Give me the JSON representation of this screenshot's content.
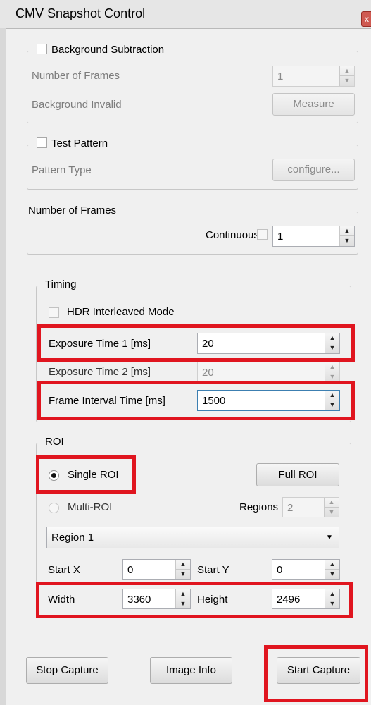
{
  "window": {
    "title": "CMV Snapshot Control",
    "close_glyph": "x"
  },
  "background_subtraction": {
    "label": "Background Subtraction",
    "frames_label": "Number of Frames",
    "frames_value": "1",
    "status_label": "Background Invalid",
    "measure_label": "Measure"
  },
  "test_pattern": {
    "label": "Test Pattern",
    "pattern_label": "Pattern Type",
    "configure_label": "configure..."
  },
  "number_of_frames": {
    "title": "Number of Frames",
    "continuous_label": "Continuous",
    "value": "1"
  },
  "timing": {
    "title": "Timing",
    "hdr_label": "HDR Interleaved Mode",
    "exposure1_label": "Exposure Time 1 [ms]",
    "exposure1_value": "20",
    "exposure2_label": "Exposure Time 2 [ms]",
    "exposure2_value": "20",
    "interval_label": "Frame Interval Time [ms]",
    "interval_value": "1500"
  },
  "roi": {
    "title": "ROI",
    "single_label": "Single ROI",
    "full_roi_label": "Full ROI",
    "multi_label": "Multi-ROI",
    "regions_label": "Regions",
    "regions_value": "2",
    "region_selected": "Region 1",
    "start_x_label": "Start X",
    "start_x_value": "0",
    "start_y_label": "Start Y",
    "start_y_value": "0",
    "width_label": "Width",
    "width_value": "3360",
    "height_label": "Height",
    "height_value": "2496"
  },
  "footer": {
    "stop_label": "Stop Capture",
    "info_label": "Image Info",
    "start_label": "Start Capture"
  },
  "icons": {
    "spin_up": "▲",
    "spin_down": "▼",
    "dropdown": "▼"
  },
  "colors": {
    "highlight": "#e0151f",
    "focus_border": "#3c7fb1",
    "titlebar": "#e6e6e6"
  }
}
